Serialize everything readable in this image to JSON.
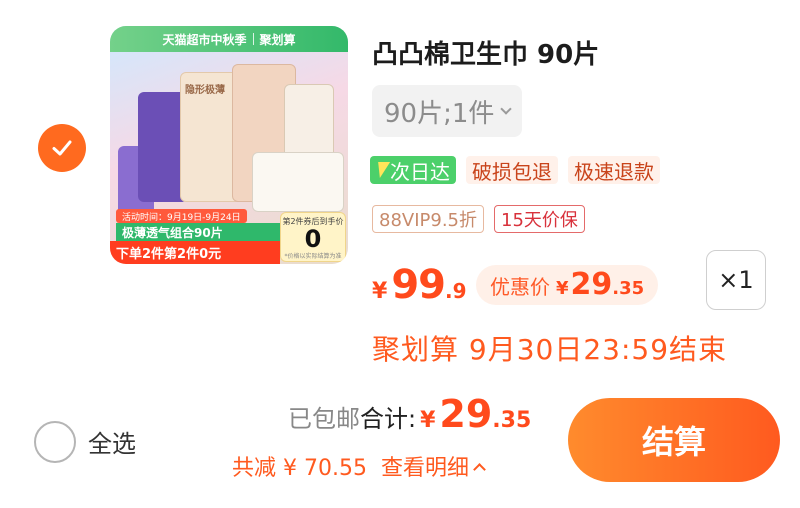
{
  "item": {
    "title": "凸凸棉卫生巾 90片",
    "variant": "90片;1件",
    "services": [
      "次日达",
      "破损包退",
      "极速退款"
    ],
    "tags": [
      "88VIP9.5折",
      "15天价保"
    ],
    "price": {
      "currency": "¥",
      "integer": "99",
      "decimal": ".9"
    },
    "deal": {
      "label": "优惠价",
      "currency": "¥",
      "integer": "29",
      "decimal": ".35"
    },
    "quantity": "×1",
    "promo_end": "聚划算 9月30日23:59结束",
    "image": {
      "banner_left": "天猫超市中秋季",
      "banner_right": "聚划算",
      "pack_label": "隐形极薄",
      "promo_date": "活动时间：9月19日-9月24日",
      "promo_green": "极薄透气组合90片",
      "promo_red": "下单2件第2件0元",
      "box_label": "第2件券后到手价",
      "box_value": "0",
      "box_note": "*价格以实际结算为准"
    }
  },
  "footer": {
    "select_all": "全选",
    "shipped": "已包邮",
    "total_label": "合计:",
    "total": {
      "currency": "¥",
      "integer": "29",
      "decimal": ".35"
    },
    "discount": "共减 ¥ 70.55",
    "detail": "查看明细",
    "checkout": "结算"
  },
  "colors": {
    "accent": "#ff5a1f",
    "price": "#ff4a1c",
    "green_service": "#4cd06a"
  }
}
